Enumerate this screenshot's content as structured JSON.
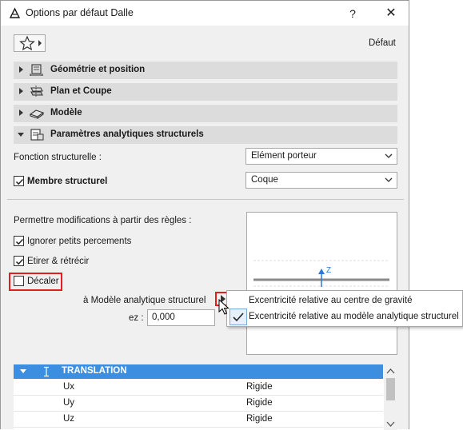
{
  "window": {
    "title": "Options par défaut Dalle",
    "help_glyph": "?",
    "close_glyph": "✕"
  },
  "toolbar": {
    "default_label": "Défaut"
  },
  "sections": [
    {
      "label": "Géométrie et position",
      "expanded": false,
      "icon": "geometry-icon"
    },
    {
      "label": "Plan et Coupe",
      "expanded": false,
      "icon": "floor-plan-icon"
    },
    {
      "label": "Modèle",
      "expanded": false,
      "icon": "model-icon"
    },
    {
      "label": "Paramètres analytiques structurels",
      "expanded": true,
      "icon": "structural-analytics-icon"
    }
  ],
  "structural": {
    "function_label": "Fonction structurelle :",
    "function_value": "Elément porteur",
    "member_label": "Membre structurel",
    "member_checked": true,
    "member_value": "Coque"
  },
  "rules": {
    "heading": "Permettre modifications à partir des règles :",
    "options": [
      {
        "label": "Ignorer petits percements",
        "checked": true
      },
      {
        "label": "Etirer & rétrécir",
        "checked": true
      },
      {
        "label": "Décaler",
        "checked": false
      }
    ],
    "analytic_model_label": "à Modèle analytique structurel",
    "ez_label": "ez :",
    "ez_value": "0,000"
  },
  "preview": {
    "axis_label": "Z"
  },
  "popup_menu": {
    "items": [
      {
        "label": "Excentricité relative au centre de gravité",
        "checked": false
      },
      {
        "label": "Excentricité relative au modèle analytique structurel",
        "checked": true
      }
    ]
  },
  "table": {
    "header": "TRANSLATION",
    "rows": [
      {
        "name": "Ux",
        "value": "Rigide"
      },
      {
        "name": "Uy",
        "value": "Rigide"
      },
      {
        "name": "Uz",
        "value": "Rigide"
      }
    ]
  },
  "colors": {
    "accent": "#3c8fe0",
    "highlight_red": "#e02020"
  }
}
